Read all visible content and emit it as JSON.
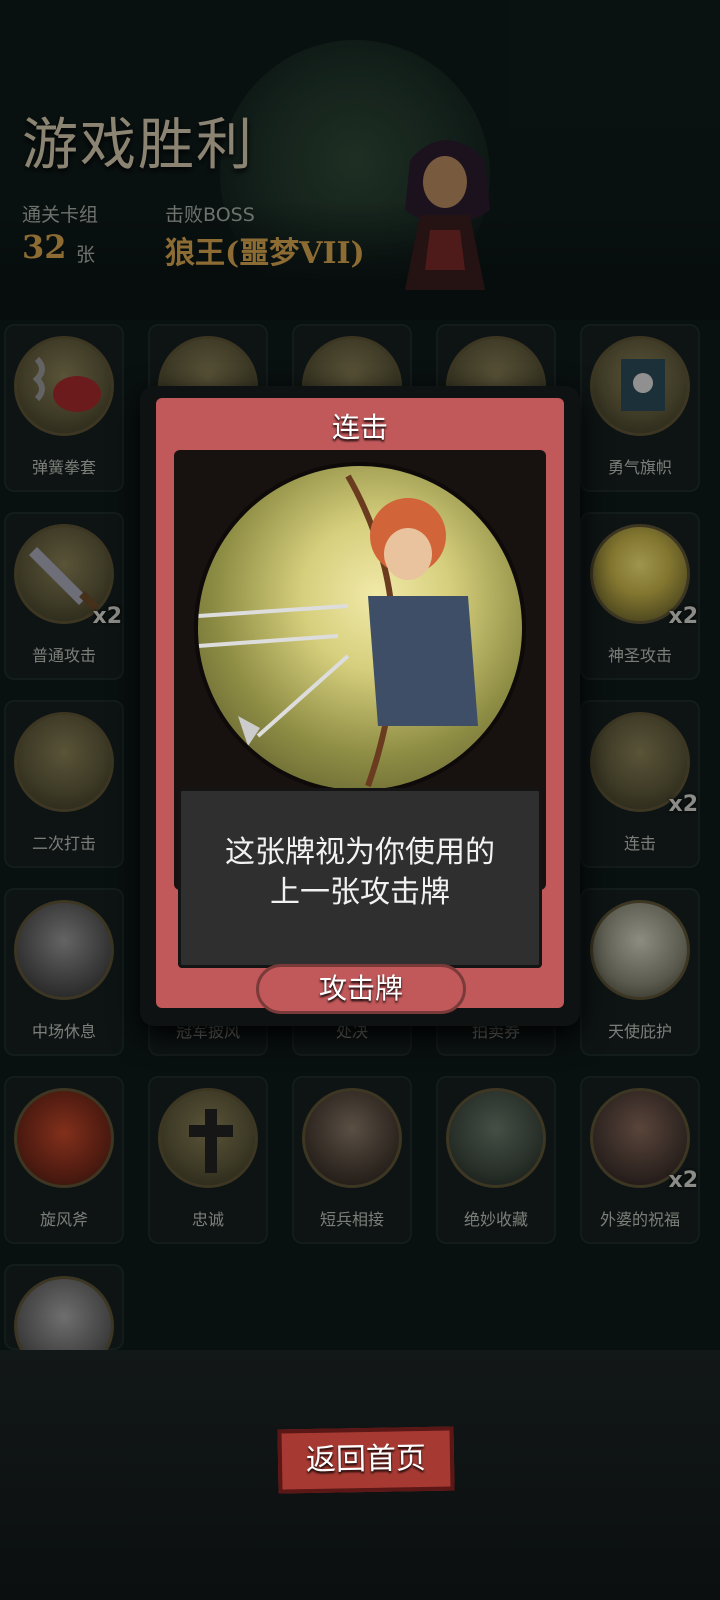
{
  "header": {
    "title": "游戏胜利",
    "deck_label": "通关卡组",
    "deck_count": "32",
    "deck_unit": "张",
    "boss_label": "击败BOSS",
    "boss_name": "狼王(噩梦VII)"
  },
  "cards": [
    {
      "label": "弹簧拳套",
      "count": ""
    },
    {
      "label": "",
      "count": ""
    },
    {
      "label": "",
      "count": ""
    },
    {
      "label": "",
      "count": ""
    },
    {
      "label": "勇气旗帜",
      "count": ""
    },
    {
      "label": "普通攻击",
      "count": "x2"
    },
    {
      "label": "神圣攻击",
      "count": "x2"
    },
    {
      "label": "二次打击",
      "count": ""
    },
    {
      "label": "连击",
      "count": "x2"
    },
    {
      "label": "中场休息",
      "count": ""
    },
    {
      "label": "冠军披风",
      "count": ""
    },
    {
      "label": "处决",
      "count": ""
    },
    {
      "label": "拍卖券",
      "count": ""
    },
    {
      "label": "天使庇护",
      "count": ""
    },
    {
      "label": "旋风斧",
      "count": ""
    },
    {
      "label": "忠诚",
      "count": ""
    },
    {
      "label": "短兵相接",
      "count": ""
    },
    {
      "label": "绝妙收藏",
      "count": ""
    },
    {
      "label": "外婆的祝福",
      "count": "x2"
    },
    {
      "label": "",
      "count": ""
    }
  ],
  "popup": {
    "title": "连击",
    "description_line1": "这张牌视为你使用的",
    "description_line2": "上一张攻击牌",
    "type": "攻击牌"
  },
  "footer": {
    "home_button": "返回首页"
  },
  "colors": {
    "accent_gold": "#d9a650",
    "card_red": "#c1585a",
    "button_red": "#a63a33"
  }
}
